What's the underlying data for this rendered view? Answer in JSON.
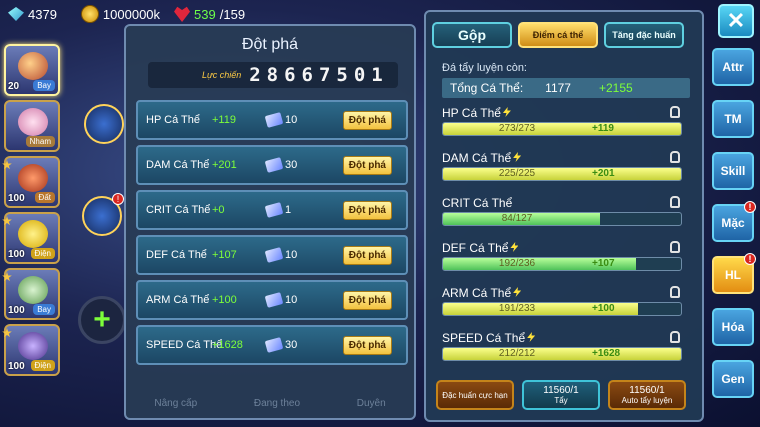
{
  "resources": {
    "gems": "4379",
    "gold": "1000000k",
    "stamina_current": "539",
    "stamina_max": "/159"
  },
  "team": [
    {
      "level": "20",
      "type": "Bay"
    },
    {
      "level": "",
      "type": "Nham"
    },
    {
      "level": "100",
      "type": "Đất"
    },
    {
      "level": "100",
      "type": "Điện"
    },
    {
      "level": "100",
      "type": "Bay"
    },
    {
      "level": "100",
      "type": "Điện"
    }
  ],
  "breakthrough": {
    "title": "Đột phá",
    "power_label": "Lực chiến",
    "power_value": "28667501",
    "button_label": "Đột phá",
    "rows": [
      {
        "name": "HP Cá Thể",
        "bonus": "+119",
        "cost": "10"
      },
      {
        "name": "DAM Cá Thể",
        "bonus": "+201",
        "cost": "30"
      },
      {
        "name": "CRIT Cá Thể",
        "bonus": "+0",
        "cost": "1"
      },
      {
        "name": "DEF Cá Thể",
        "bonus": "+107",
        "cost": "10"
      },
      {
        "name": "ARM Cá Thể",
        "bonus": "+100",
        "cost": "10"
      },
      {
        "name": "SPEED Cá Thể",
        "bonus": "+1628",
        "cost": "30"
      }
    ],
    "footer": [
      "Nâng cấp",
      "Đang theo",
      "Duyên"
    ]
  },
  "individual": {
    "tabs": [
      "Gộp",
      "Điểm cá thể",
      "Tăng đặc huấn"
    ],
    "remain_label": "Đá tẩy luyện còn:",
    "total_label": "Tổng Cá Thể:",
    "total_value": "1177",
    "total_bonus": "+2155",
    "bars": [
      {
        "name": "HP Cá Thể",
        "value": "273/273",
        "bonus": "+119",
        "fill": 1.0,
        "green": false
      },
      {
        "name": "DAM Cá Thể",
        "value": "225/225",
        "bonus": "+201",
        "fill": 1.0,
        "green": false
      },
      {
        "name": "CRIT Cá Thể",
        "value": "84/127",
        "bonus": "",
        "fill": 0.66,
        "green": true
      },
      {
        "name": "DEF Cá Thể",
        "value": "192/236",
        "bonus": "+107",
        "fill": 0.81,
        "green": true
      },
      {
        "name": "ARM Cá Thể",
        "value": "191/233",
        "bonus": "+100",
        "fill": 0.82,
        "green": false
      },
      {
        "name": "SPEED Cá Thể",
        "value": "212/212",
        "bonus": "+1628",
        "fill": 1.0,
        "green": false
      }
    ],
    "actions": {
      "special": "Đặc huấn cực hạn",
      "wash_count": "11560/1",
      "wash_label": "Tẩy",
      "auto_count": "11560/1",
      "auto_label": "Auto tẩy luyện"
    }
  },
  "side_nav": [
    "Attr",
    "TM",
    "Skill",
    "Mặc",
    "HL",
    "Hóa",
    "Gen"
  ],
  "badge": "!"
}
